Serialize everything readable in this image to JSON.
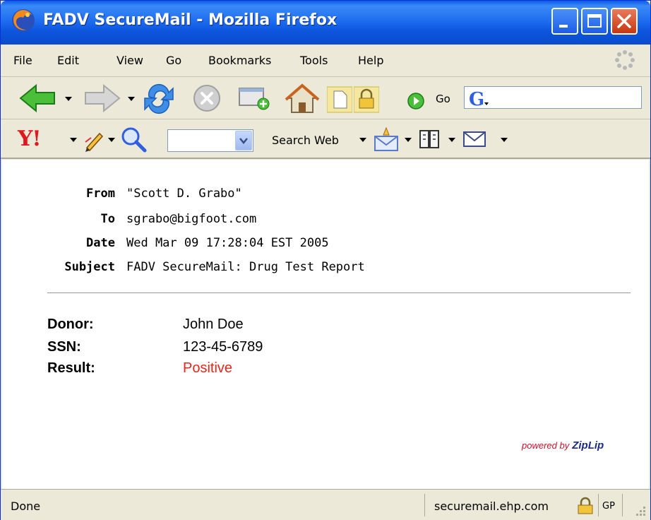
{
  "window": {
    "title": "FADV SecureMail - Mozilla Firefox"
  },
  "menu": {
    "items": [
      "File",
      "Edit",
      "View",
      "Go",
      "Bookmarks",
      "Tools",
      "Help"
    ]
  },
  "navbar": {
    "go_label": "Go",
    "search_engine_icon": "google-icon"
  },
  "yahoo_toolbar": {
    "logo": "Y!",
    "search_label": "Search Web"
  },
  "email": {
    "from_label": "From",
    "from_value": "\"Scott D. Grabo\"",
    "to_label": "To",
    "to_value": "sgrabo@bigfoot.com",
    "date_label": "Date",
    "date_value": "Wed Mar 09 17:28:04 EST 2005",
    "subject_label": "Subject",
    "subject_value": "FADV SecureMail: Drug Test Report"
  },
  "report": {
    "donor_label": "Donor:",
    "donor_value": "John Doe",
    "ssn_label": "SSN:",
    "ssn_value": "123-45-6789",
    "result_label": "Result:",
    "result_value": "Positive",
    "result_color": "#e8261e"
  },
  "footer": {
    "powered_by": "powered by",
    "brand": "ZipLip"
  },
  "status": {
    "text": "Done",
    "url": "securemail.ehp.com",
    "gp": "GP"
  },
  "colors": {
    "titlebar": "#0a5ae6",
    "chrome": "#ece9d8",
    "close_button": "#c8370f"
  }
}
